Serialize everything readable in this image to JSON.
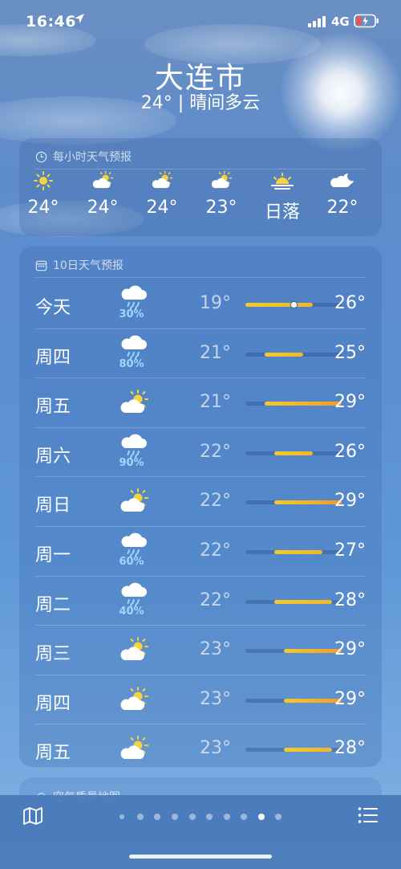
{
  "status": {
    "time": "16:46",
    "network": "4G"
  },
  "header": {
    "city": "大连市",
    "summary": "24° | 晴间多云"
  },
  "hourly": {
    "title": "每小时天气预报",
    "items": [
      {
        "icon": "sun-icon",
        "value": "24°"
      },
      {
        "icon": "partly-cloudy-icon",
        "value": "24°"
      },
      {
        "icon": "partly-cloudy-icon",
        "value": "24°"
      },
      {
        "icon": "partly-cloudy-icon",
        "value": "23°"
      },
      {
        "icon": "sunset-icon",
        "value": "日落"
      },
      {
        "icon": "cloud-moon-icon",
        "value": "22°"
      }
    ]
  },
  "daily": {
    "title": "10日天气预报",
    "range_min": 19,
    "range_max": 29,
    "current_temp": 24,
    "days": [
      {
        "day": "今天",
        "icon": "rain-icon",
        "precip": "30%",
        "low": "19°",
        "high": "26°",
        "lo": 19,
        "hi": 26
      },
      {
        "day": "周四",
        "icon": "rain-icon",
        "precip": "80%",
        "low": "21°",
        "high": "25°",
        "lo": 21,
        "hi": 25
      },
      {
        "day": "周五",
        "icon": "partly-cloudy-icon",
        "precip": "",
        "low": "21°",
        "high": "29°",
        "lo": 21,
        "hi": 29
      },
      {
        "day": "周六",
        "icon": "rain-icon",
        "precip": "90%",
        "low": "22°",
        "high": "26°",
        "lo": 22,
        "hi": 26
      },
      {
        "day": "周日",
        "icon": "partly-cloudy-icon",
        "precip": "",
        "low": "22°",
        "high": "29°",
        "lo": 22,
        "hi": 29
      },
      {
        "day": "周一",
        "icon": "rain-icon",
        "precip": "60%",
        "low": "22°",
        "high": "27°",
        "lo": 22,
        "hi": 27
      },
      {
        "day": "周二",
        "icon": "rain-icon",
        "precip": "40%",
        "low": "22°",
        "high": "28°",
        "lo": 22,
        "hi": 28
      },
      {
        "day": "周三",
        "icon": "partly-cloudy-icon",
        "precip": "",
        "low": "23°",
        "high": "29°",
        "lo": 23,
        "hi": 29
      },
      {
        "day": "周四",
        "icon": "partly-cloudy-icon",
        "precip": "",
        "low": "23°",
        "high": "29°",
        "lo": 23,
        "hi": 29
      },
      {
        "day": "周五",
        "icon": "partly-cloudy-icon",
        "precip": "",
        "low": "23°",
        "high": "28°",
        "lo": 23,
        "hi": 28
      }
    ]
  },
  "air_quality": {
    "title": "空气质量地图"
  },
  "pager": {
    "count": 10,
    "active_index": 8
  },
  "colors": {
    "warm": "#f2cb2b",
    "hot": "#f39a2c",
    "precip": "#9fd8ff"
  }
}
